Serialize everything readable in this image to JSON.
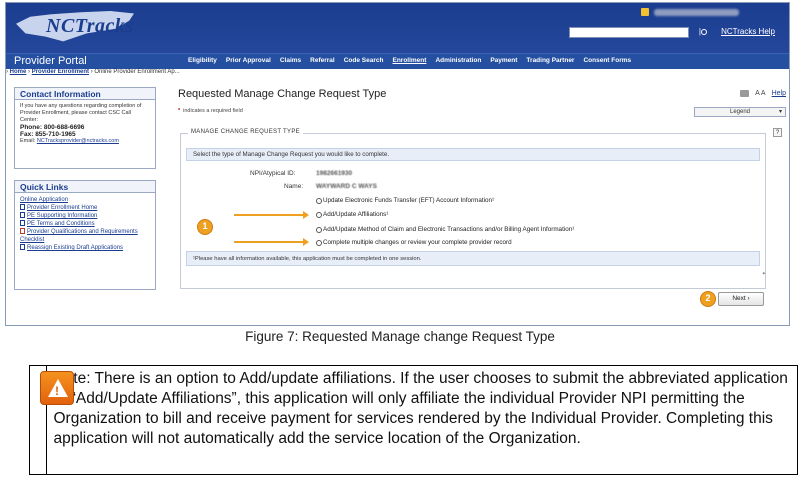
{
  "header": {
    "logo_text": "NCTracks",
    "help_link": "NCTracks Help"
  },
  "navbar": {
    "portal_title": "Provider Portal",
    "items": [
      "Eligibility",
      "Prior Approval",
      "Claims",
      "Referral",
      "Code Search",
      "Enrollment",
      "Administration",
      "Payment",
      "Trading Partner",
      "Consent Forms"
    ],
    "active": "Enrollment"
  },
  "breadcrumb": {
    "home": "Home",
    "provider_enrollment": "Provider Enrollment",
    "current": "Online Provider Enrollment Ap..."
  },
  "contact": {
    "title": "Contact Information",
    "intro": "If you have any questions regarding completion of Provider Enrollment, please contact CSC Call Center:",
    "phone_label": "Phone:",
    "phone": "800-688-6696",
    "fax_label": "Fax:",
    "fax": "855-710-1965",
    "email_label": "Email:",
    "email": "NCTracksprovider@nctracks.com"
  },
  "quick_links": {
    "title": "Quick Links",
    "items": [
      {
        "label": "Online Application",
        "icon": "none"
      },
      {
        "label": "Provider Enrollment Home",
        "icon": "doc-icon"
      },
      {
        "label": "PE Supporting Information",
        "icon": "doc-icon"
      },
      {
        "label": "PE Terms and Conditions",
        "icon": "doc-icon"
      },
      {
        "label": "Provider Qualifications and Requirements Checklist",
        "icon": "pdf-icon"
      },
      {
        "label": "Reassign Existing Draft Applications",
        "icon": "doc-icon"
      }
    ]
  },
  "main": {
    "title": "Requested Manage Change Request Type",
    "required_note": "indicates a required field",
    "text_size": "A A",
    "help": "Help",
    "legend_select": "Legend",
    "fieldset_legend": "MANAGE CHANGE REQUEST TYPE",
    "question_mark": "?",
    "instruction": "Select the type of Manage Change Request you would like to complete.",
    "npi_label": "NPI/Atypical ID:",
    "npi_value": "1982661930",
    "name_label": "Name:",
    "name_value": "WAYWARD C WAYS",
    "options": [
      "Update Electronic Funds Transfer (EFT) Account Information¹",
      "Add/Update Affiliations¹",
      "Add/Update Method of Claim and Electronic Transactions and/or Billing Agent Information¹",
      "Complete multiple changes or review your complete provider record"
    ],
    "footnote": "¹Please have all information available, this application must be completed in one session.",
    "next_button": "Next",
    "callout_1": "1",
    "callout_2": "2"
  },
  "caption": "Figure 7: Requested Manage change Request Type",
  "note": {
    "text": "Note: There is an option to Add/update affiliations. If the user chooses to submit the abbreviated application to “Add/Update Affiliations”, this application will only affiliate the individual Provider NPI permitting the Organization to bill and receive payment for services rendered by the Individual Provider. Completing this application will not automatically add the service location of the Organization."
  },
  "colors": {
    "brand_blue": "#1b3d8f",
    "callout_orange": "#f0a020",
    "warning_orange": "#e2620d"
  }
}
